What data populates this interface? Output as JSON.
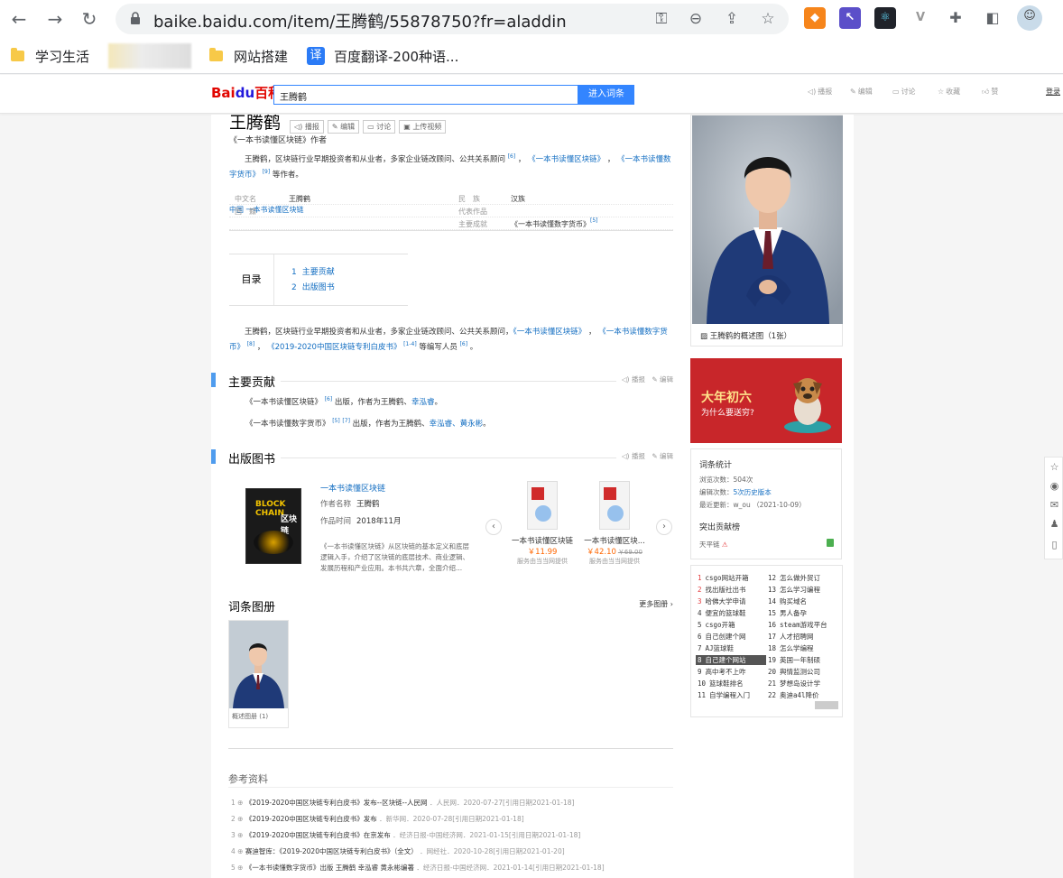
{
  "browser": {
    "url": "baike.baidu.com/item/王腾鹤/55878750?fr=aladdin",
    "bookmarks": [
      "学习生活",
      "网站搭建",
      "百度翻译-200种语..."
    ],
    "translate_glyph": "译"
  },
  "baike_header": {
    "logo_left": "Bai",
    "logo_paw": "du",
    "logo_right": "百科",
    "search_value": "王腾鹤",
    "search_button": "进入词条",
    "actions": [
      "播报",
      "编辑",
      "讨论",
      "收藏",
      "赞"
    ],
    "login": "登录"
  },
  "entry": {
    "title": "王腾鹤",
    "title_buttons": [
      "播报",
      "编辑",
      "讨论",
      "上传视频"
    ],
    "subtitle": "《一本书读懂区块链》作者",
    "summary_a": "王腾鹤，区块链行业早期投资者和从业者，多家企业链改顾问、公共关系顾问",
    "summary_sup1": "[6]",
    "summary_link1": "《一本书读懂区块链》",
    "summary_link2": "《一本书读懂数字货币》",
    "summary_sup2": "[9]",
    "summary_end": "等作者。",
    "info": {
      "name_label": "中文名",
      "name_value": "王腾鹤",
      "ethnic_label": "民　族",
      "ethnic_value": "汉族",
      "nation_label": "国　籍",
      "nation_value": "中国",
      "works_label": "代表作品",
      "works_value": "一本书读懂区块链",
      "achieve_label": "主要成就",
      "achieve_value": "《一本书读懂数字货币》",
      "achieve_sup": "[5]"
    },
    "toc": {
      "title": "目录",
      "items": [
        {
          "num": "1",
          "label": "主要贡献"
        },
        {
          "num": "2",
          "label": "出版图书"
        }
      ]
    },
    "intro_a": "王腾鹤，区块链行业早期投资者和从业者，多家企业链改顾问、公共关系顾问，",
    "intro_link1": "《一本书读懂区块链》",
    "intro_link2": "《一本书读懂数字货币》",
    "intro_sup1": "[8]",
    "intro_link3": "《2019-2020中国区块链专利白皮书》",
    "intro_sup2": "[1-4]",
    "intro_mid": "等编写人员",
    "intro_sup3": "[6]",
    "intro_end": "。",
    "section_actions": {
      "play": "播报",
      "edit": "编辑"
    },
    "contrib": {
      "title": "主要贡献",
      "line1_a": "《一本书读懂区块链》",
      "line1_sup": "[6]",
      "line1_b": "出版，作者为王腾鹤、",
      "line1_link": "幸泓睿",
      "line1_end": "。",
      "line2_a": "《一本书读懂数字货币》",
      "line2_sup1": "[5]",
      "line2_sup2": "[7]",
      "line2_b": "出版，作者为王腾鹤、",
      "line2_link": "幸泓睿、黄永彬",
      "line2_end": "。"
    },
    "books": {
      "title": "出版图书",
      "cover_en": "BLOCK CHAIN",
      "cover_cn": "区块链",
      "book_title": "一本书读懂区块链",
      "author_label": "作者名称",
      "author": "王腾鹤",
      "time_label": "作品时间",
      "time": "2018年11月",
      "desc": "《一本书读懂区块链》从区块链的基本定义和底层逻辑入手，介绍了区块链的底层技术、商业逻辑、发展历程和产业应用。本书共六章，全面介绍...",
      "products": [
        {
          "name": "一本书读懂区块链",
          "price": "￥11.99",
          "old": "",
          "service": "服务由当当网提供"
        },
        {
          "name": "一本书读懂区块...",
          "price": "￥42.10",
          "old": "￥69.00",
          "service": "服务由当当网提供"
        }
      ]
    },
    "album": {
      "title": "词条图册",
      "more": "更多图册",
      "caption": "概述图册 (1)"
    },
    "refs": {
      "title": "参考资料",
      "items": [
        {
          "num": "1",
          "title": "《2019-2020中国区块链专利白皮书》发布--区块链--人民网",
          "meta": "．人民网．2020-07-27[引用日期2021-01-18]"
        },
        {
          "num": "2",
          "title": "《2019-2020中国区块链专利白皮书》发布",
          "meta": "．新华网．2020-07-28[引用日期2021-01-18]"
        },
        {
          "num": "3",
          "title": "《2019-2020中国区块链专利白皮书》在京发布",
          "meta": "．经济日报-中国经济网．2021-01-15[引用日期2021-01-18]"
        },
        {
          "num": "4",
          "title": "赛迪智库：《2019-2020中国区块链专利白皮书》（全文）",
          "meta": "．网经社．2020-10-28[引用日期2021-01-20]"
        },
        {
          "num": "5",
          "title": "《一本书读懂数字货币》出版 王腾鹤 幸泓睿 黄永彬编著",
          "meta": "．经济日报-中国经济网．2021-01-14[引用日期2021-01-18]"
        }
      ]
    }
  },
  "sidebar": {
    "photo_caption": "王腾鹤的概述图（1张）",
    "ad_title": "大年初六",
    "ad_sub": "为什么要送穷?",
    "stats": {
      "title": "词条统计",
      "views_label": "浏览次数：",
      "views": "504次",
      "edits_label": "编辑次数：",
      "edits": "5次历史版本",
      "updated_label": "最近更新：",
      "updated": "w_ou （2021-10-09）",
      "contrib_title": "突出贡献榜",
      "contrib_name": "天平链"
    },
    "hot": [
      {
        "num": "1",
        "label": "csgo网站开箱"
      },
      {
        "num": "2",
        "label": "找出版社出书"
      },
      {
        "num": "3",
        "label": "哈佛大学申请"
      },
      {
        "num": "4",
        "label": "便宜的篮球鞋"
      },
      {
        "num": "5",
        "label": "csgo开箱"
      },
      {
        "num": "6",
        "label": "自己创建个网"
      },
      {
        "num": "7",
        "label": "AJ篮球鞋"
      },
      {
        "num": "8",
        "label": "自己建个网站"
      },
      {
        "num": "9",
        "label": "高中考不上咋"
      },
      {
        "num": "10",
        "label": "篮球鞋排名"
      },
      {
        "num": "11",
        "label": "自学编程入门"
      },
      {
        "num": "12",
        "label": "怎么做外贸订"
      },
      {
        "num": "13",
        "label": "怎么学习编程"
      },
      {
        "num": "14",
        "label": "购买域名"
      },
      {
        "num": "15",
        "label": "男人备孕"
      },
      {
        "num": "16",
        "label": "steam游戏平台"
      },
      {
        "num": "17",
        "label": "人才招聘网"
      },
      {
        "num": "18",
        "label": "怎么学编程"
      },
      {
        "num": "19",
        "label": "英国一年制硕"
      },
      {
        "num": "20",
        "label": "舆情监测公司"
      },
      {
        "num": "21",
        "label": "梦想岛设计学"
      },
      {
        "num": "22",
        "label": "奥迪a4l降价"
      }
    ]
  }
}
